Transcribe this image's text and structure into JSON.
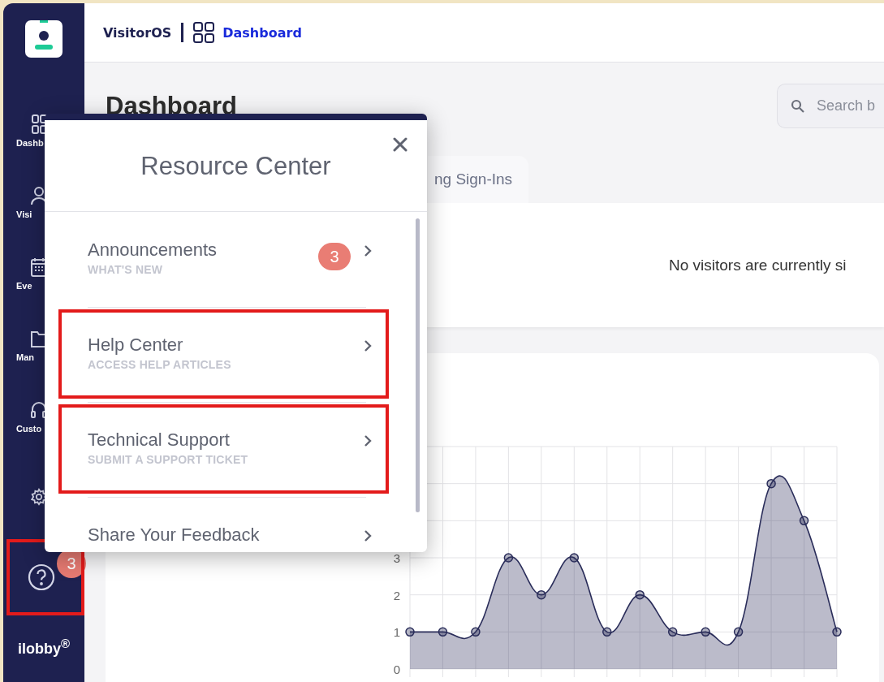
{
  "header": {
    "app_name": "VisitorOS",
    "page": "Dashboard"
  },
  "sidebar": {
    "items": [
      {
        "kind": "grid",
        "label": "Dashb"
      },
      {
        "kind": "person",
        "label": "Visi"
      },
      {
        "kind": "calendar",
        "label": "Eve"
      },
      {
        "kind": "folder",
        "label": "Man"
      },
      {
        "kind": "headset",
        "label": "Custo"
      }
    ],
    "help": {
      "badge": "3",
      "highlighted": true
    },
    "brand": "ilobby$^{®}$"
  },
  "page": {
    "title": "Dashboard",
    "search": {
      "placeholder": "Search b"
    },
    "tabs": [
      {
        "label": "ng Sign-Ins",
        "selected": false
      }
    ],
    "empty_message": "No visitors are currently si",
    "chart_data": {
      "type": "area",
      "grid": true,
      "ylim": [
        0,
        6
      ],
      "yticks": [
        0,
        1,
        2,
        3
      ],
      "series": [
        {
          "color": "#2a2d5a",
          "values": [
            1,
            1,
            1,
            3,
            2,
            3,
            1,
            2,
            1,
            1,
            1,
            5,
            4,
            1
          ]
        }
      ]
    }
  },
  "resource_center": {
    "title": "Resource Center",
    "items": [
      {
        "title": "Announcements",
        "subtitle": "WHAT'S NEW",
        "badge": "3",
        "highlighted": false
      },
      {
        "title": "Help Center",
        "subtitle": "ACCESS HELP ARTICLES",
        "highlighted": true
      },
      {
        "title": "Technical Support",
        "subtitle": "SUBMIT A SUPPORT TICKET",
        "highlighted": true
      },
      {
        "title": "Share Your Feedback",
        "highlighted": false
      }
    ]
  }
}
